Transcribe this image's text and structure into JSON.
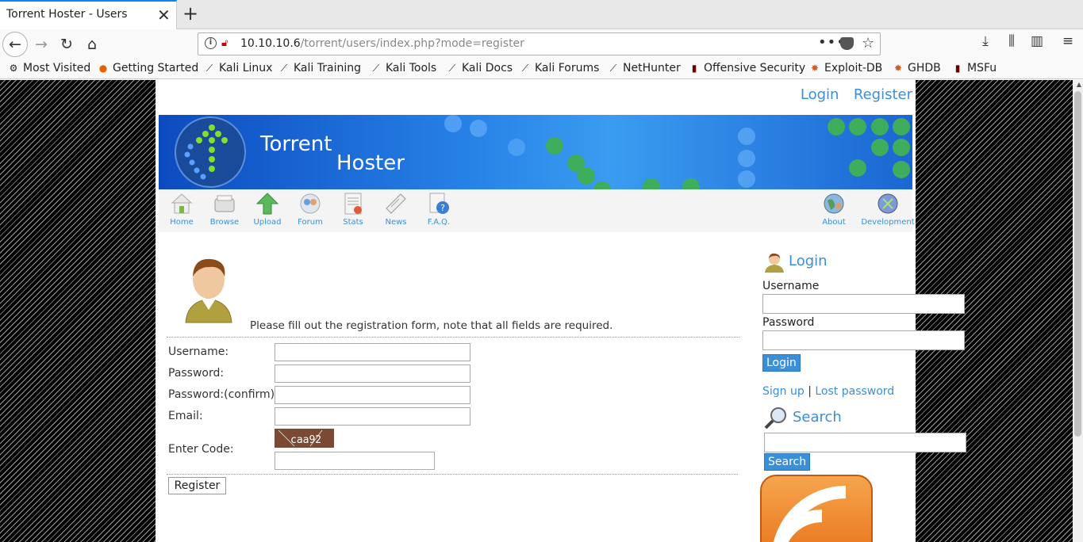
{
  "browser": {
    "tab_title": "Torrent Hoster - Users",
    "tab_close": "✕",
    "new_tab": "+",
    "url_host": "10.10.10.6",
    "url_path": "/torrent/users/index.php?mode=register",
    "url_more": "•••"
  },
  "bookmarks": [
    {
      "label": "Most Visited",
      "icon": "gear-icon"
    },
    {
      "label": "Getting Started",
      "icon": "firefox-icon"
    },
    {
      "label": "Kali Linux",
      "icon": "kali-icon"
    },
    {
      "label": "Kali Training",
      "icon": "kali-icon"
    },
    {
      "label": "Kali Tools",
      "icon": "kali-icon"
    },
    {
      "label": "Kali Docs",
      "icon": "kali-icon"
    },
    {
      "label": "Kali Forums",
      "icon": "kali-icon"
    },
    {
      "label": "NetHunter",
      "icon": "kali-icon"
    },
    {
      "label": "Offensive Security",
      "icon": "offsec-icon"
    },
    {
      "label": "Exploit-DB",
      "icon": "exploitdb-icon"
    },
    {
      "label": "GHDB",
      "icon": "exploitdb-icon"
    },
    {
      "label": "MSFu",
      "icon": "offsec-icon"
    }
  ],
  "site": {
    "top_links": {
      "login": "Login",
      "register": "Register"
    },
    "logo_line1": "Torrent",
    "logo_line2": "Hoster",
    "nav": [
      {
        "label": "Home",
        "icon": "home-icon",
        "color": "#7ab648"
      },
      {
        "label": "Browse",
        "icon": "browse-icon",
        "color": "#d8d8d8"
      },
      {
        "label": "Upload",
        "icon": "upload-arrow-icon",
        "color": "#5cb85c"
      },
      {
        "label": "Forum",
        "icon": "forum-icon",
        "color": "#6aa0d8"
      },
      {
        "label": "Stats",
        "icon": "stats-icon",
        "color": "#c8c8c8"
      },
      {
        "label": "News",
        "icon": "news-icon",
        "color": "#d0d0d0"
      },
      {
        "label": "F.A.Q.",
        "icon": "faq-icon",
        "color": "#3b7fd0"
      }
    ],
    "nav_right": [
      {
        "label": "About",
        "icon": "globe-icon",
        "color": "#5a9a5a"
      },
      {
        "label": "Development",
        "icon": "development-icon",
        "color": "#7a9ad8"
      }
    ]
  },
  "form": {
    "intro": "Please fill out the registration form, note that all fields are required.",
    "fields": [
      {
        "label": "Username:",
        "value": ""
      },
      {
        "label": "Password:",
        "value": ""
      },
      {
        "label": "Password:(confirm)",
        "value": ""
      },
      {
        "label": "Email:",
        "value": ""
      }
    ],
    "code_label": "Enter Code:",
    "captcha": "caa92",
    "code_value": "",
    "submit": "Register"
  },
  "sidebar": {
    "login_title": "Login",
    "username_label": "Username",
    "password_label": "Password",
    "login_button": "Login",
    "signup": "Sign up",
    "separator": "|",
    "lost_password": "Lost password",
    "search_title": "Search",
    "search_button": "Search"
  },
  "colors": {
    "accent": "#3b8fd9",
    "banner": "#1b66d3",
    "captcha_bg": "#7a4a35"
  }
}
